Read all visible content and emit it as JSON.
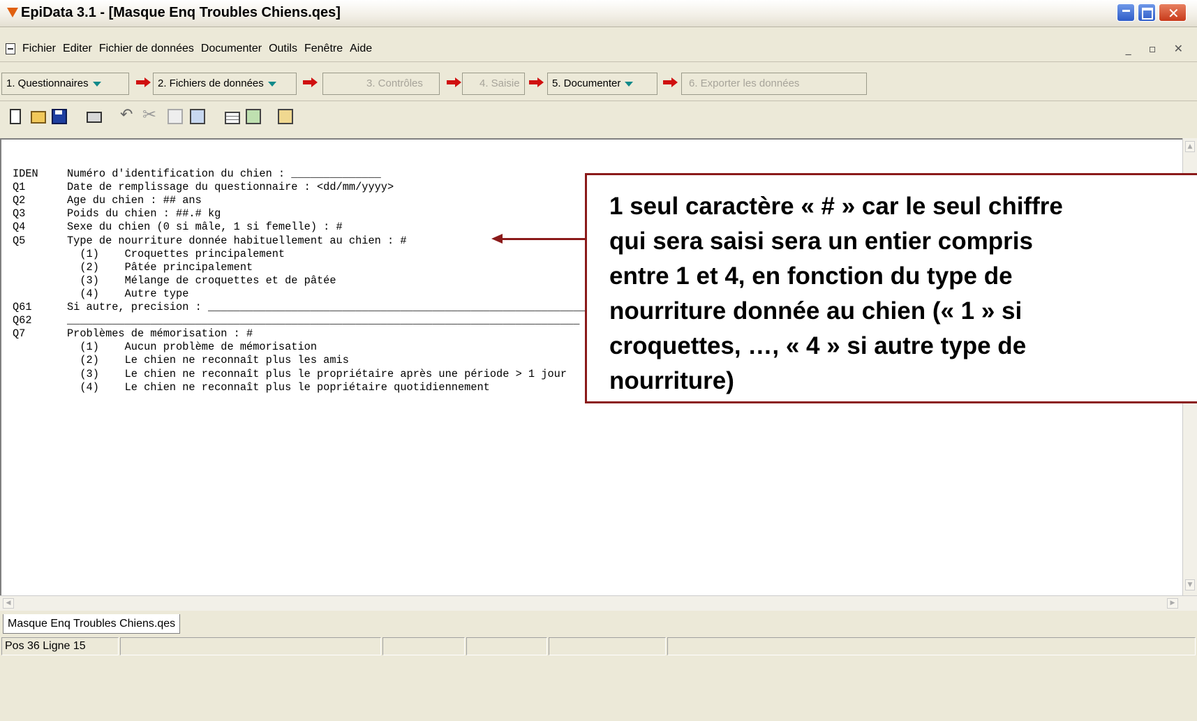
{
  "window": {
    "title": "EpiData 3.1 - [Masque Enq Troubles Chiens.qes]"
  },
  "menu": [
    "Fichier",
    "Editer",
    "Fichier de données",
    "Documenter",
    "Outils",
    "Fenêtre",
    "Aide"
  ],
  "workflow": [
    {
      "label": "1. Questionnaires",
      "enabled": true,
      "dropdown": true
    },
    {
      "label": "2. Fichiers de données",
      "enabled": true,
      "dropdown": true
    },
    {
      "label": "3. Contrôles",
      "enabled": false,
      "dropdown": false
    },
    {
      "label": "4. Saisie",
      "enabled": false,
      "dropdown": false
    },
    {
      "label": "5. Documenter",
      "enabled": true,
      "dropdown": true
    },
    {
      "label": "6. Exporter les données",
      "enabled": false,
      "dropdown": false
    }
  ],
  "toolbar_icons": [
    "new-file-icon",
    "open-folder-icon",
    "save-icon",
    "print-icon",
    "undo-icon",
    "cut-icon",
    "copy-icon",
    "paste-icon",
    "table-icon",
    "wizard-icon",
    "check-icon"
  ],
  "editor": {
    "lines": [
      {
        "label": "IDEN",
        "text": "Numéro d'identification du chien : ______________"
      },
      {
        "label": "Q1",
        "text": "Date de remplissage du questionnaire : <dd/mm/yyyy>"
      },
      {
        "label": "Q2",
        "text": "Age du chien : ## ans"
      },
      {
        "label": "Q3",
        "text": "Poids du chien : ##.# kg"
      },
      {
        "label": "Q4",
        "text": "Sexe du chien (0 si mâle, 1 si femelle) : #"
      },
      {
        "label": "Q5",
        "text": "Type de nourriture donnée habituellement au chien : #"
      },
      {
        "label": "",
        "text": "  (1)    Croquettes principalement"
      },
      {
        "label": "",
        "text": "  (2)    Pâtée principalement"
      },
      {
        "label": "",
        "text": "  (3)    Mélange de croquettes et de pâtée"
      },
      {
        "label": "",
        "text": "  (4)    Autre type"
      },
      {
        "label": "Q61",
        "text": "Si autre, precision : _______________________________________________________________"
      },
      {
        "label": "Q62",
        "text": "________________________________________________________________________________"
      },
      {
        "label": "Q7",
        "text": "Problèmes de mémorisation : #"
      },
      {
        "label": "",
        "text": "  (1)    Aucun problème de mémorisation"
      },
      {
        "label": "",
        "text": "  (2)    Le chien ne reconnaît plus les amis"
      },
      {
        "label": "",
        "text": "  (3)    Le chien ne reconnaît plus le propriétaire après une période > 1 jour"
      },
      {
        "label": "",
        "text": "  (4)    Le chien ne reconnaît plus le popriétaire quotidiennement"
      }
    ]
  },
  "callout": {
    "lines": [
      "1 seul caractère « # » car le seul chiffre",
      "qui sera saisi sera un entier compris",
      "entre 1 et 4, en fonction du type de",
      "nourriture donnée au chien (« 1 » si",
      "croquettes, …, « 4 » si autre type de",
      "nourriture)"
    ]
  },
  "document_tab": "Masque Enq Troubles Chiens.qes",
  "status": {
    "position": "Pos 36  Ligne 15"
  },
  "colors": {
    "callout_border": "#8b1a1a",
    "workflow_arrow": "#d01010",
    "window_bg": "#ece9d8"
  }
}
